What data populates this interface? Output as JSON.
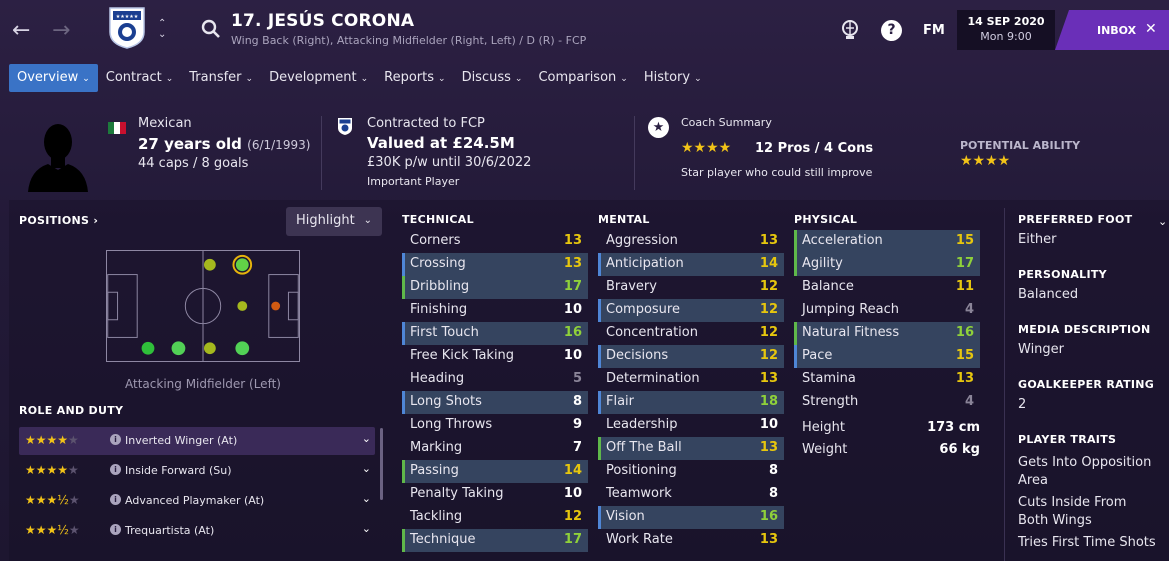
{
  "header": {
    "player_name": "17. JESÚS CORONA",
    "positions": "Wing Back (Right), Attacking Midfielder (Right, Left) / D (R) - FCP",
    "fm_label": "FM",
    "help_label": "?",
    "date": "14 SEP 2020",
    "time": "Mon 9:00",
    "inbox_label": "INBOX"
  },
  "tabs": [
    {
      "label": "Overview"
    },
    {
      "label": "Contract"
    },
    {
      "label": "Transfer"
    },
    {
      "label": "Development"
    },
    {
      "label": "Reports"
    },
    {
      "label": "Discuss"
    },
    {
      "label": "Comparison"
    },
    {
      "label": "History"
    }
  ],
  "info": {
    "nationality": "Mexican",
    "age": "27 years old",
    "dob": "(6/1/1993)",
    "caps": "44 caps / 8 goals",
    "contract_title": "Contracted to FCP",
    "value": "Valued at £24.5M",
    "wage": "£30K p/w until 30/6/2022",
    "status": "Important Player",
    "coach_title": "Coach Summary",
    "coach_stars": "★★★★",
    "pros_cons": "12 Pros / 4 Cons",
    "coach_summary": "Star player who could still improve",
    "potential_title": "POTENTIAL ABILITY",
    "potential_stars": "★★★★"
  },
  "positions_panel": {
    "title": "POSITIONS",
    "highlight_label": "Highlight",
    "selected_position": "Attacking Midfielder (Left)"
  },
  "roles": {
    "title": "ROLE AND DUTY",
    "items": [
      {
        "stars": "★★★★",
        "empty": "★",
        "name": "Inverted Winger (At)"
      },
      {
        "stars": "★★★★",
        "empty": "★",
        "name": "Inside Forward (Su)"
      },
      {
        "stars": "★★★½",
        "empty": "★",
        "name": "Advanced Playmaker (At)"
      },
      {
        "stars": "★★★½",
        "empty": "★",
        "name": "Trequartista (At)"
      }
    ]
  },
  "technical": {
    "title": "TECHNICAL",
    "items": [
      {
        "name": "Corners",
        "value": "13"
      },
      {
        "name": "Crossing",
        "value": "13"
      },
      {
        "name": "Dribbling",
        "value": "17"
      },
      {
        "name": "Finishing",
        "value": "10"
      },
      {
        "name": "First Touch",
        "value": "16"
      },
      {
        "name": "Free Kick Taking",
        "value": "10"
      },
      {
        "name": "Heading",
        "value": "5"
      },
      {
        "name": "Long Shots",
        "value": "8"
      },
      {
        "name": "Long Throws",
        "value": "9"
      },
      {
        "name": "Marking",
        "value": "7"
      },
      {
        "name": "Passing",
        "value": "14"
      },
      {
        "name": "Penalty Taking",
        "value": "10"
      },
      {
        "name": "Tackling",
        "value": "12"
      },
      {
        "name": "Technique",
        "value": "17"
      }
    ]
  },
  "mental": {
    "title": "MENTAL",
    "items": [
      {
        "name": "Aggression",
        "value": "13"
      },
      {
        "name": "Anticipation",
        "value": "14"
      },
      {
        "name": "Bravery",
        "value": "12"
      },
      {
        "name": "Composure",
        "value": "12"
      },
      {
        "name": "Concentration",
        "value": "12"
      },
      {
        "name": "Decisions",
        "value": "12"
      },
      {
        "name": "Determination",
        "value": "13"
      },
      {
        "name": "Flair",
        "value": "18"
      },
      {
        "name": "Leadership",
        "value": "10"
      },
      {
        "name": "Off The Ball",
        "value": "13"
      },
      {
        "name": "Positioning",
        "value": "8"
      },
      {
        "name": "Teamwork",
        "value": "8"
      },
      {
        "name": "Vision",
        "value": "16"
      },
      {
        "name": "Work Rate",
        "value": "13"
      }
    ]
  },
  "physical": {
    "title": "PHYSICAL",
    "items": [
      {
        "name": "Acceleration",
        "value": "15"
      },
      {
        "name": "Agility",
        "value": "17"
      },
      {
        "name": "Balance",
        "value": "11"
      },
      {
        "name": "Jumping Reach",
        "value": "4"
      },
      {
        "name": "Natural Fitness",
        "value": "16"
      },
      {
        "name": "Pace",
        "value": "15"
      },
      {
        "name": "Stamina",
        "value": "13"
      },
      {
        "name": "Strength",
        "value": "4"
      }
    ],
    "height_label": "Height",
    "height": "173 cm",
    "weight_label": "Weight",
    "weight": "66 kg"
  },
  "right_panel": {
    "foot_title": "PREFERRED FOOT",
    "foot": "Either",
    "personality_title": "PERSONALITY",
    "personality": "Balanced",
    "media_title": "MEDIA DESCRIPTION",
    "media": "Winger",
    "gk_title": "GOALKEEPER RATING",
    "gk": "2",
    "traits_title": "PLAYER TRAITS",
    "traits": [
      "Gets Into Opposition Area",
      "Cuts Inside From Both Wings",
      "Tries First Time Shots"
    ]
  },
  "colors": {
    "accent_tab": "#3a73c6",
    "inbox": "#6a2fb8",
    "star": "#f2c318",
    "great": "#8fd13a",
    "good": "#e6c60e"
  }
}
